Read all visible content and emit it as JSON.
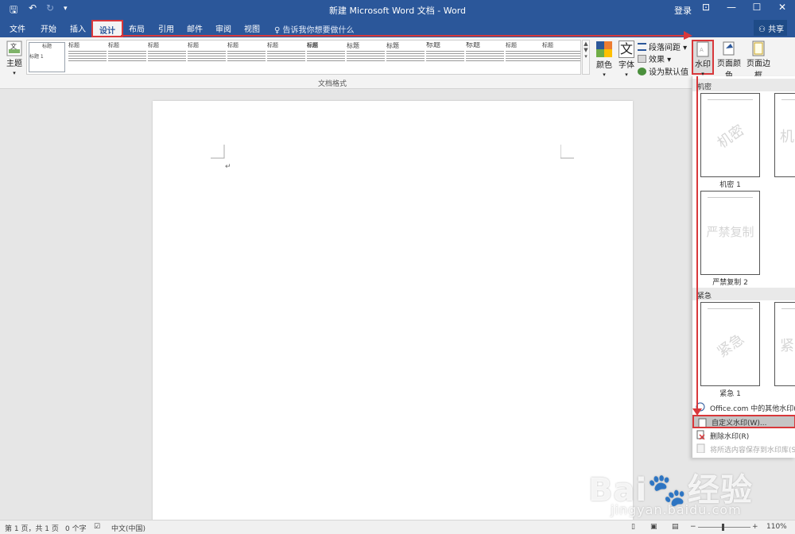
{
  "window": {
    "title": "新建 Microsoft Word 文档 - Word",
    "login": "登录",
    "controls": {
      "ribbon_display": "⊡",
      "minimize": "—",
      "maximize": "☐",
      "close": "✕"
    }
  },
  "quick_access": {
    "save": "🖫",
    "undo": "↶",
    "redo": "↻",
    "customize": "▾"
  },
  "tabs": [
    {
      "label": "文件"
    },
    {
      "label": "开始"
    },
    {
      "label": "插入"
    },
    {
      "label": "设计",
      "active": true
    },
    {
      "label": "布局"
    },
    {
      "label": "引用"
    },
    {
      "label": "邮件"
    },
    {
      "label": "审阅"
    },
    {
      "label": "视图"
    }
  ],
  "tell_me": "告诉我你想要做什么",
  "share": "共享",
  "ribbon": {
    "theme": "主题",
    "colors": "颜色",
    "fonts": "字体",
    "font_icon_glyph": "文",
    "paragraph_spacing": "段落间距",
    "effects": "效果",
    "set_default": "设为默认值",
    "watermark": "水印",
    "page_color": "页面颜色",
    "page_borders": "页面边框",
    "group_label": "文档格式",
    "style_titles": [
      "标题",
      "标题",
      "标题",
      "标题",
      "标题",
      "标题",
      "标题",
      "标题",
      "标题",
      "标题",
      "标题",
      "标题",
      "标题",
      "标题"
    ],
    "first_style_heading": "标题 1"
  },
  "watermark_menu": {
    "categories": [
      "机密",
      "紧急"
    ],
    "thumbnails": [
      {
        "caption": "机密 1",
        "text": "机密"
      },
      {
        "caption": "",
        "text": "机"
      },
      {
        "caption": "严禁复制 2",
        "text": "严禁复制"
      },
      {
        "caption": "紧急 1",
        "text": "紧急"
      },
      {
        "caption": "",
        "text": "紧"
      }
    ],
    "items": [
      {
        "label": "Office.com 中的其他水印(M)"
      },
      {
        "label": "自定义水印(W)..."
      },
      {
        "label": "删除水印(R)"
      },
      {
        "label": "将所选内容保存到水印库(S)..."
      }
    ]
  },
  "document": {
    "paragraph_mark": "↵"
  },
  "status": {
    "page": "第 1 页，共 1 页",
    "words": "0 个字",
    "language": "中文(中国)",
    "zoom": "110%"
  },
  "overlay": {
    "brand": "Bai🐾经验",
    "site": "jingyan.baidu.com"
  },
  "colors": {
    "accent": "#2b579a",
    "annotation": "#d8383b"
  }
}
